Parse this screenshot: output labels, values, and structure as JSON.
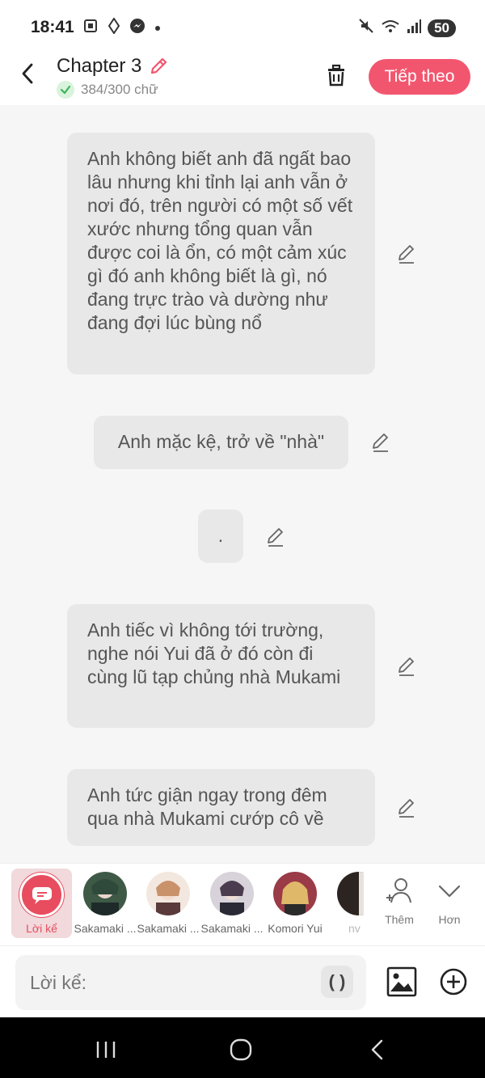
{
  "status_bar": {
    "time": "18:41",
    "left_icons": [
      "screenshot-icon",
      "location-icon",
      "messenger-icon",
      "dot-icon"
    ],
    "right_icons": [
      "mute-icon",
      "wifi-icon",
      "signal-icon"
    ],
    "battery": "50"
  },
  "header": {
    "title": "Chapter 3",
    "word_count": "384/300 chữ",
    "next_button": "Tiếp theo"
  },
  "messages": [
    {
      "text": "Anh không biết anh đã ngất bao lâu nhưng khi tỉnh lại anh vẫn ở nơi đó, trên người có một số vết xước nhưng tổng quan vẫn được coi là ổn, có một cảm xúc gì đó anh không biết là gì, nó đang trực trào và dường như đang đợi lúc bùng nổ"
    },
    {
      "text": "Anh mặc kệ, trở về \"nhà\""
    },
    {
      "text": "."
    },
    {
      "text": "Anh tiếc vì không tới trường, nghe nói Yui đã ở đó còn đi cùng lũ tạp chủng nhà Mukami"
    },
    {
      "text": "Anh tức giận ngay trong đêm qua nhà Mukami cướp cô về"
    }
  ],
  "character_bar": {
    "narrator_label": "Lời kể",
    "characters": [
      {
        "name": "Sakamaki ...",
        "color": "#3e5a46"
      },
      {
        "name": "Sakamaki ...",
        "color": "#c9926b"
      },
      {
        "name": "Sakamaki ...",
        "color": "#4a3c4e"
      },
      {
        "name": "Komori Yui",
        "color": "#e0b86a"
      },
      {
        "name": "nv",
        "color": "#2c2420"
      }
    ],
    "more_label": "Thêm",
    "less_label": "Hơn"
  },
  "input": {
    "placeholder": "Lời kể:",
    "paren_label": "( )"
  },
  "colors": {
    "accent": "#f2566f",
    "bubble": "#e8e8e8",
    "background": "#f6f6f6"
  }
}
